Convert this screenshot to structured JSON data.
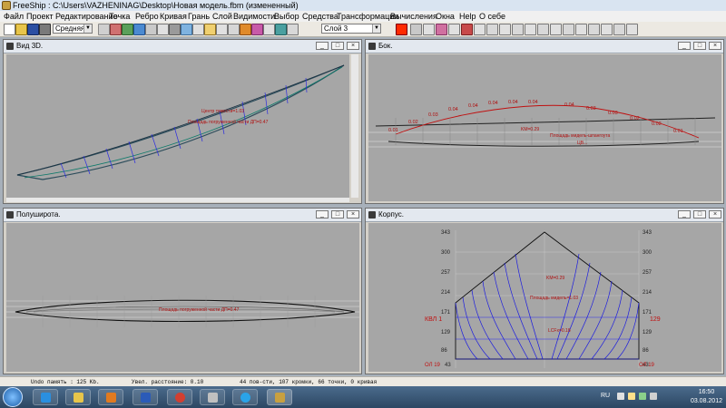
{
  "window": {
    "title": "FreeShip  : C:\\Users\\VAZHENINAG\\Desktop\\Новая модель.fbm (измененный)"
  },
  "menu": [
    "Файл",
    "Проект",
    "Редактирование",
    "Точка",
    "Ребро",
    "Кривая",
    "Грань",
    "Слой",
    "Видимости",
    "Выбор",
    "Средства",
    "Трансформации",
    "Вычисления",
    "Окна",
    "Help",
    "О себе"
  ],
  "toolbar": {
    "precision": "Средняя",
    "layer": "Слой 3",
    "layer_color": "#ff2a00"
  },
  "views": {
    "v3d": {
      "title": "Вид 3D.",
      "ann1": "Центр тяжести=1.03",
      "ann2": "Площадь погруженной части ДП=0.47"
    },
    "side": {
      "title": "Бок.",
      "labels": [
        "0.01",
        "0.02",
        "0.03",
        "0.04",
        "0.04",
        "0.04",
        "0.04",
        "0.04",
        "0.04",
        "0.03",
        "0.03",
        "0.02",
        "0.02",
        "0.01"
      ],
      "ann1": "KM=0.29",
      "ann2": "Площадь мидель-шпангоута",
      "ann3": "ЦВ..."
    },
    "plan": {
      "title": "Полуширота.",
      "ann": "Площадь погруженной части ДП=0.47"
    },
    "body": {
      "title": "Корпус.",
      "ticks_left": [
        "343",
        "300",
        "257",
        "214",
        "171",
        "129",
        "86",
        "43"
      ],
      "ticks_right": [
        "343",
        "300",
        "257",
        "214",
        "171",
        "129",
        "86",
        "43"
      ],
      "ann_top": "KM=0.29",
      "ann_mid": "Площадь мидель=1.03",
      "ann_lcf": "LCFx=0.18",
      "left_wl": "КВЛ 1",
      "right_wl": "129",
      "bl_left": "ОЛ 19",
      "bl_right": "ОЛ 19"
    }
  },
  "status": {
    "undo": "Undo память : 125 Kb.",
    "dist": "Увел. расстояние: 0.10",
    "stats": "44 пов-сти, 107 кромки, 66 точки, 0 кривая"
  },
  "taskbar": {
    "lang": "RU",
    "time": "16:50",
    "date": "03.08.2012"
  }
}
